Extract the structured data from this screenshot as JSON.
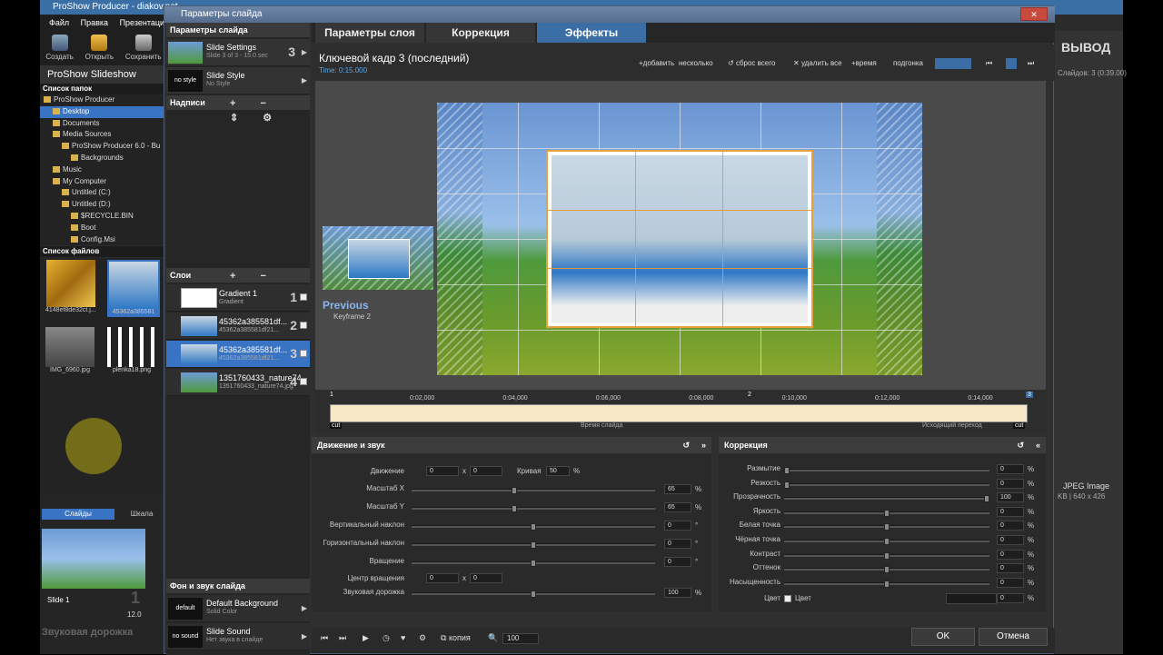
{
  "app": {
    "title": "ProShow Producer - diakov.net",
    "menu": [
      "Файл",
      "Правка",
      "Презентация"
    ],
    "toolbar": [
      "Создать",
      "Открыть",
      "Сохранить"
    ],
    "name": "ProShow Slideshow",
    "folders_header": "Список папок",
    "folders": [
      {
        "label": "ProShow Producer",
        "indent": 0,
        "selected": false
      },
      {
        "label": "Desktop",
        "indent": 1,
        "selected": true
      },
      {
        "label": "Documents",
        "indent": 1,
        "selected": false
      },
      {
        "label": "Media Sources",
        "indent": 1,
        "selected": false
      },
      {
        "label": "ProShow Producer 6.0 - Bu",
        "indent": 2,
        "selected": false
      },
      {
        "label": "Backgrounds",
        "indent": 3,
        "selected": false
      },
      {
        "label": "Music",
        "indent": 1,
        "selected": false
      },
      {
        "label": "My Computer",
        "indent": 1,
        "selected": false
      },
      {
        "label": "Untitled (C:)",
        "indent": 2,
        "selected": false
      },
      {
        "label": "Untitled (D:)",
        "indent": 2,
        "selected": false
      },
      {
        "label": "$RECYCLE.BIN",
        "indent": 3,
        "selected": false
      },
      {
        "label": "Boot",
        "indent": 3,
        "selected": false
      },
      {
        "label": "Config.Msi",
        "indent": 3,
        "selected": false
      }
    ],
    "files_header": "Список файлов",
    "files": [
      "4148ef8de32ct.j...",
      "45362a385581",
      "IMG_6960.jpg",
      "plenka18.png"
    ],
    "slides_tabs": [
      "Слайды",
      "Шкала"
    ],
    "slide": {
      "label": "Slide 1",
      "num": "1",
      "duration": "12.0"
    },
    "sound_track": "Звуковая дорожка",
    "right_title": "ВЫВОД",
    "right_slides": "Слайдов: 3 (0:39.00)",
    "right_file_type": "JPEG Image",
    "right_file_info": "KB | 640 x 426"
  },
  "dialog": {
    "title": "Параметры слайда",
    "close": "✕",
    "slide_params_header": "Параметры слайда",
    "slide_settings": {
      "title": "Slide Settings",
      "sub": "Slide 3 of 3 - 15.0 sec",
      "num": "3"
    },
    "slide_style": {
      "title": "Slide Style",
      "sub": "No Style",
      "badge": "no style"
    },
    "captions_header": "Надписи",
    "layers_header": "Слои",
    "layers": [
      {
        "title": "Gradient 1",
        "sub": "Gradient",
        "num": "1",
        "selected": false
      },
      {
        "title": "45362a385581df...",
        "sub": "45362a385581df21...",
        "num": "2",
        "selected": false
      },
      {
        "title": "45362a385581df...",
        "sub": "45362a385581df21...",
        "num": "3",
        "selected": true
      },
      {
        "title": "1351760433_nature74",
        "sub": "1351760433_nature74.jpg",
        "num": "4",
        "selected": false
      }
    ],
    "bg_header": "Фон и звук слайда",
    "bg": {
      "title": "Default Background",
      "sub": "Solid Color",
      "badge": "default"
    },
    "sound": {
      "title": "Slide Sound",
      "sub": "Нет звука в слайде",
      "badge": "no sound"
    },
    "tabs": [
      "Параметры слоя",
      "Коррекция",
      "Эффекты"
    ],
    "active_tab": 2,
    "keyframe_title": "Ключевой кадр 3 (последний)",
    "keyframe_time": "Time: 0:15.000",
    "kf_buttons": [
      "+добавить",
      "несколько",
      "сброс всего",
      "удалить все",
      "+время",
      "подгонка"
    ],
    "previous_label": "Previous",
    "previous_sub": "Keyframe 2",
    "timeline_ticks": [
      "0:02,000",
      "0:04,000",
      "0:06,000",
      "0:08,000",
      "0:10,000",
      "0:12,000",
      "0:14,000"
    ],
    "timeline_markers": [
      "1",
      "2",
      "3"
    ],
    "timeline_cut": "cut",
    "timeline_slide_time": "Время слайда",
    "timeline_transition": "Исходящий переход",
    "motion": {
      "header": "Движение и звук",
      "movement_label": "Движение",
      "movement_x": "0",
      "movement_y": "0",
      "curve_label": "Кривая",
      "curve_value": "50",
      "xy_x": "x",
      "xy_y": "x",
      "rows": [
        {
          "label": "Масштаб X",
          "value": "65",
          "unit": "%",
          "pos": 0.42
        },
        {
          "label": "Масштаб Y",
          "value": "65",
          "unit": "%",
          "pos": 0.42
        },
        {
          "label": "Вертикальный наклон",
          "value": "0",
          "unit": "°",
          "pos": 0.5
        },
        {
          "label": "Горизонтальный наклон",
          "value": "0",
          "unit": "°",
          "pos": 0.5
        },
        {
          "label": "Вращение",
          "value": "0",
          "unit": "°",
          "pos": 0.5
        }
      ],
      "center_label": "Центр вращения",
      "center_x": "0",
      "center_y": "0",
      "audio_label": "Звуковая дорожка",
      "audio_value": "100",
      "audio_unit": "%",
      "audio_pos": 0.5
    },
    "correction": {
      "header": "Коррекция",
      "rows": [
        {
          "label": "Размытие",
          "value": "0",
          "unit": "%",
          "pos": 0.0
        },
        {
          "label": "Резкость",
          "value": "0",
          "unit": "%",
          "pos": 0.0
        },
        {
          "label": "Прозрачность",
          "value": "100",
          "unit": "%",
          "pos": 1.0
        },
        {
          "label": "Яркость",
          "value": "0",
          "unit": "%",
          "pos": 0.5
        },
        {
          "label": "Белая точка",
          "value": "0",
          "unit": "%",
          "pos": 0.5
        },
        {
          "label": "Чёрная точка",
          "value": "0",
          "unit": "%",
          "pos": 0.5
        },
        {
          "label": "Контраст",
          "value": "0",
          "unit": "%",
          "pos": 0.5
        },
        {
          "label": "Оттенок",
          "value": "0",
          "unit": "%",
          "pos": 0.5
        },
        {
          "label": "Насыщенность",
          "value": "0",
          "unit": "%",
          "pos": 0.5
        }
      ],
      "color_label": "Цвет",
      "color_check_label": "Цвет",
      "color_value": "0",
      "color_unit": "%"
    },
    "bottom": {
      "copy": "копия",
      "zoom": "100",
      "ok": "OK",
      "cancel": "Отмена"
    }
  }
}
